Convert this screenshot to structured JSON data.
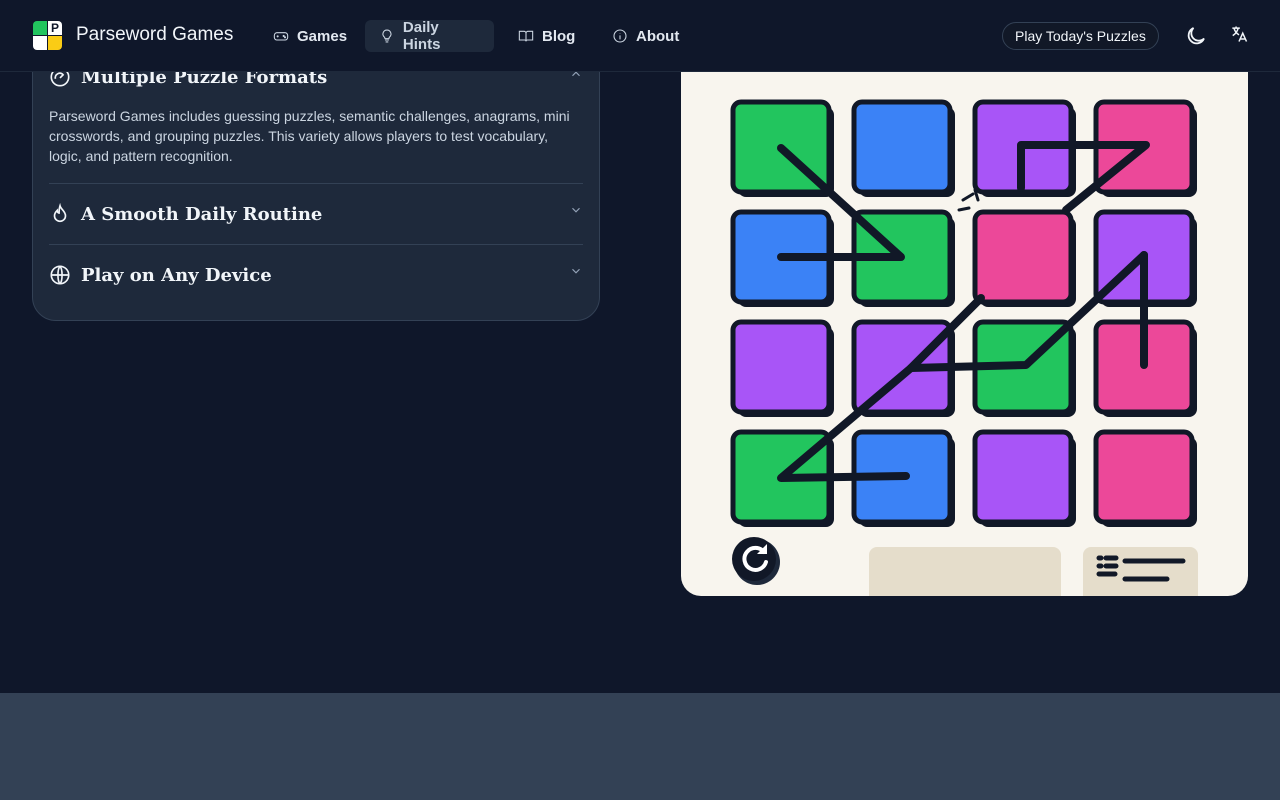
{
  "header": {
    "brand": "Parseword Games",
    "logo_letter": "P",
    "nav": [
      {
        "label": "Games",
        "icon": "gamepad-icon",
        "active": false
      },
      {
        "label": "Daily Hints",
        "icon": "lightbulb-icon",
        "active": true
      },
      {
        "label": "Blog",
        "icon": "book-icon",
        "active": false
      },
      {
        "label": "About",
        "icon": "info-icon",
        "active": false
      }
    ],
    "play_button": "Play Today's Puzzles",
    "theme_icon": "moon-icon",
    "language_icon": "translate-icon"
  },
  "accordion": {
    "items": [
      {
        "title": "Multiple Puzzle Formats",
        "icon": "gauge-icon",
        "expanded": true,
        "body": "Parseword Games includes guessing puzzles, semantic challenges, anagrams, mini crosswords, and grouping puzzles. This variety allows players to test vocabulary, logic, and pattern recognition."
      },
      {
        "title": "A Smooth Daily Routine",
        "icon": "flame-icon",
        "expanded": false
      },
      {
        "title": "Play on Any Device",
        "icon": "globe-icon",
        "expanded": false
      }
    ]
  },
  "illustration": {
    "grid_colors": [
      [
        "#22c55e",
        "#3b82f6",
        "#a855f7",
        "#ec4899"
      ],
      [
        "#3b82f6",
        "#22c55e",
        "#ec4899",
        "#a855f7"
      ],
      [
        "#a855f7",
        "#a855f7",
        "#22c55e",
        "#ec4899"
      ],
      [
        "#22c55e",
        "#3b82f6",
        "#a855f7",
        "#ec4899"
      ]
    ],
    "refresh_icon": "refresh-icon",
    "list_icon": "list-icon"
  },
  "colors": {
    "background": "#0f172a",
    "card": "#1e293b",
    "footer": "#334155"
  }
}
